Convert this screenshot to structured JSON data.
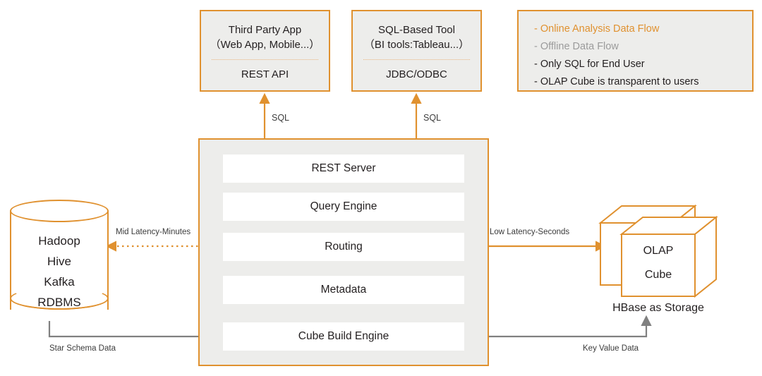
{
  "colors": {
    "orange": "#e0912f",
    "orange_light": "#e9b57e",
    "gray_fill": "#ededeb",
    "gray_line": "#808080",
    "text": "#231f20"
  },
  "clients": [
    {
      "title_line1": "Third Party App",
      "title_line2": "（Web App, Mobile...）",
      "protocol": "REST API",
      "arrow_label": "SQL"
    },
    {
      "title_line1": "SQL-Based Tool",
      "title_line2": "（BI tools:Tableau...）",
      "protocol": "JDBC/ODBC",
      "arrow_label": "SQL"
    }
  ],
  "legend": {
    "items": [
      {
        "label": "- Online Analysis Data Flow",
        "color": "#e0912f",
        "arrow": "double-arrow-orange"
      },
      {
        "label": "- Offline Data Flow",
        "color": "#9b9b9b",
        "arrow": "double-arrow-gray"
      },
      {
        "label": "- Only SQL for End User",
        "color": "#231f20",
        "arrow": ""
      },
      {
        "label": "- OLAP Cube is transparent to users",
        "color": "#231f20",
        "arrow": ""
      }
    ]
  },
  "main_panel": {
    "layers": [
      "REST Server",
      "Query Engine",
      "Routing",
      "Metadata",
      "Cube Build Engine"
    ]
  },
  "source_store": {
    "lines": [
      "Hadoop",
      "Hive",
      "Kafka",
      "RDBMS"
    ]
  },
  "cube": {
    "line1": "OLAP",
    "line2": "Cube",
    "caption": "HBase  as Storage"
  },
  "edges": {
    "mid_latency": "Mid Latency-Minutes",
    "low_latency": "Low Latency-Seconds",
    "star_schema": "Star Schema Data",
    "key_value": "Key Value Data"
  }
}
